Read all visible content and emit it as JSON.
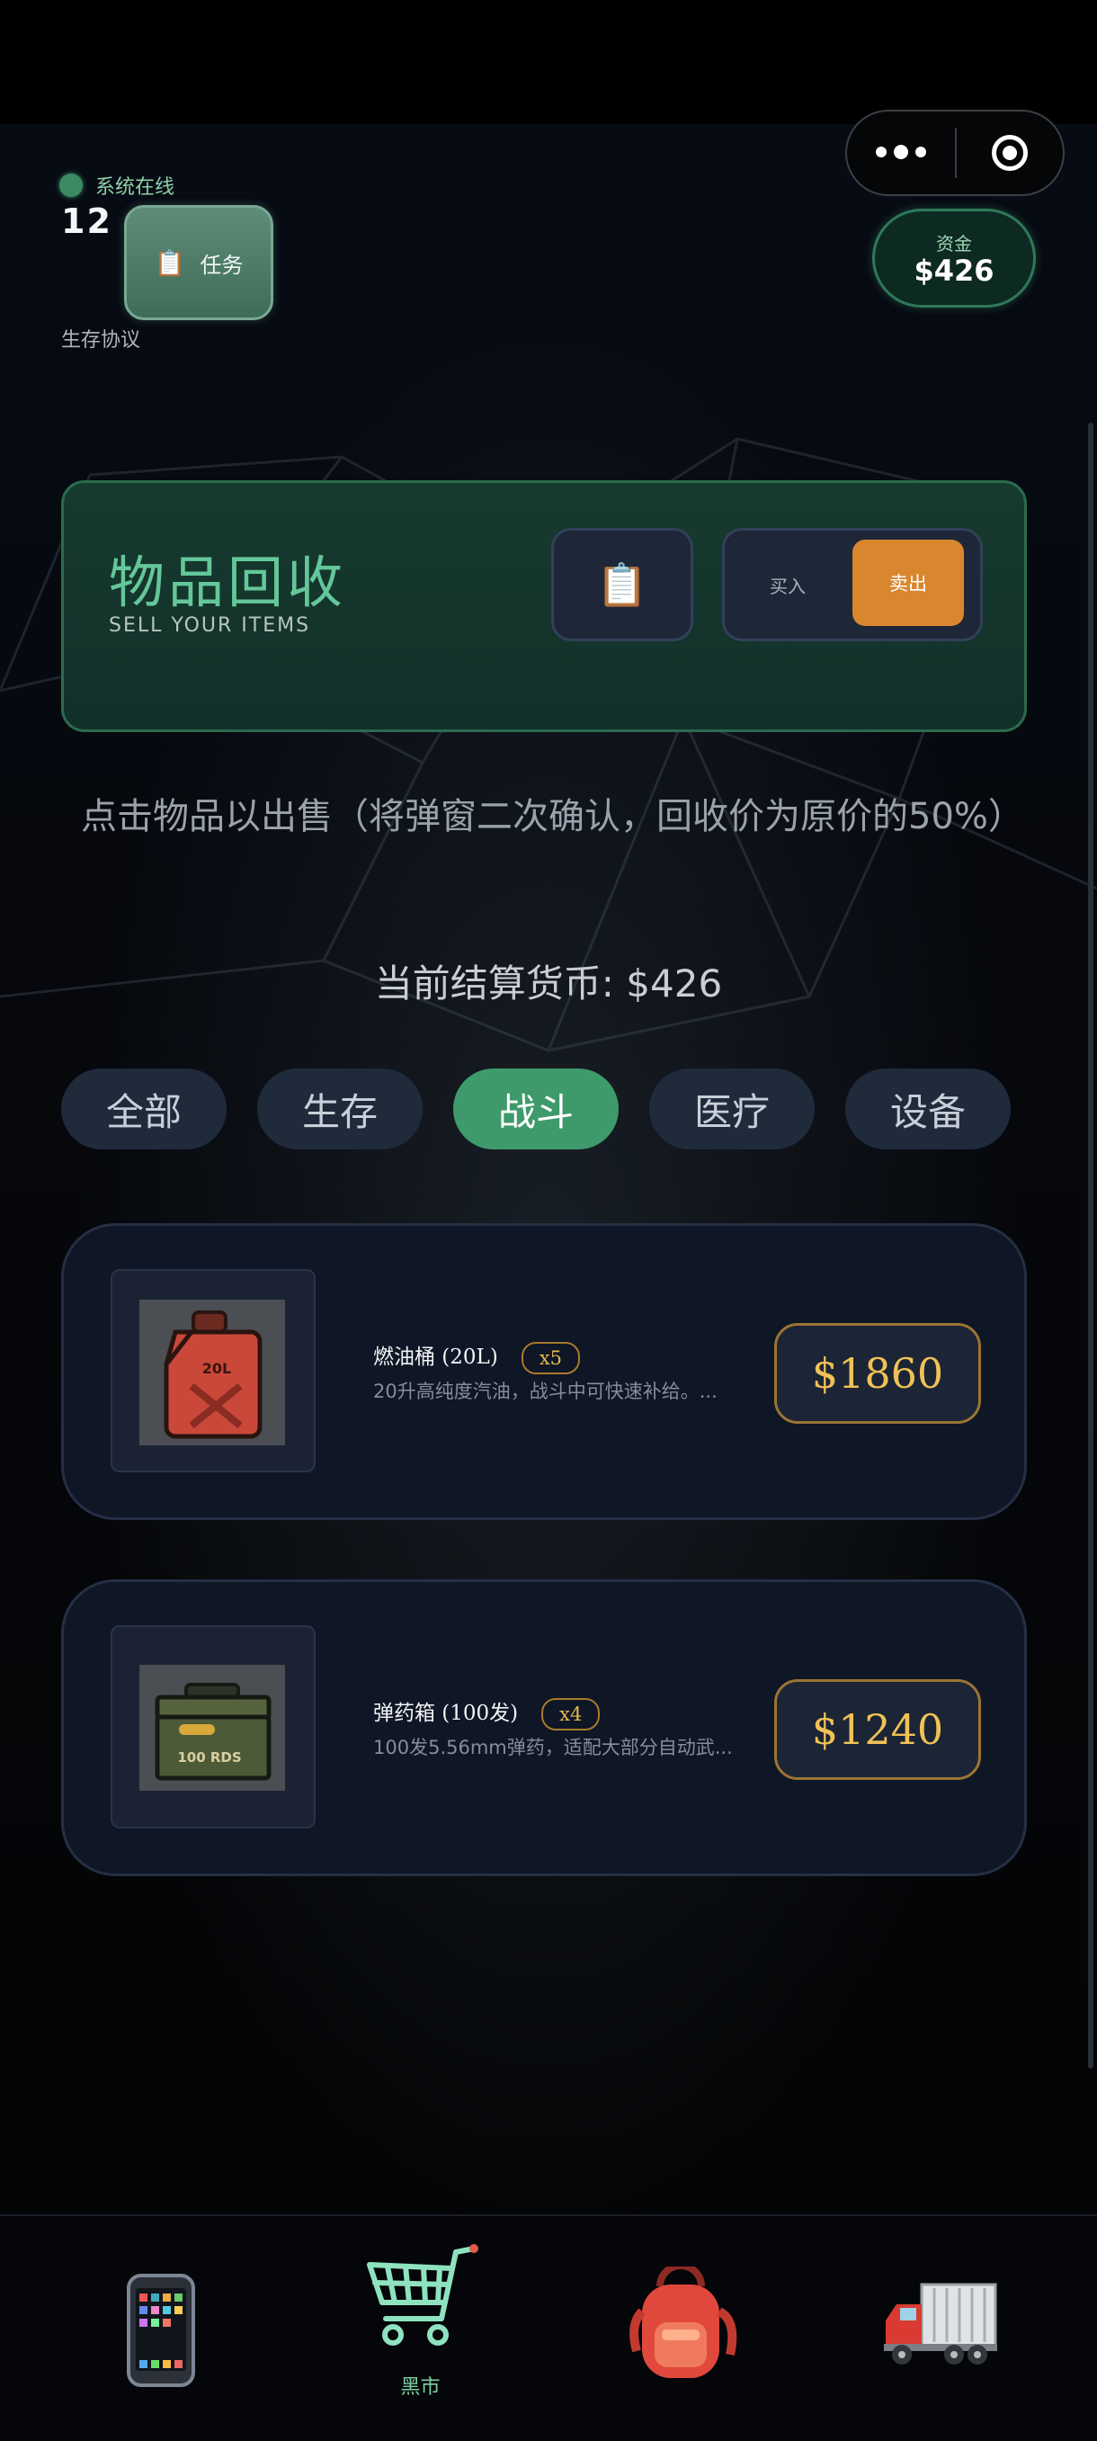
{
  "status": {
    "label": "系统在线",
    "indicator_color": "#3a8a62"
  },
  "player": {
    "level": "12",
    "protocol_label": "生存协议"
  },
  "task_button": {
    "icon": "clipboard-icon",
    "label": "任务"
  },
  "capsule": {
    "more_icon": "more-dots-icon",
    "close_icon": "target-circle-icon"
  },
  "funds": {
    "label": "资金",
    "value": "$426"
  },
  "hero": {
    "title": "物品回收",
    "subtitle": "SELL YOUR ITEMS",
    "clipboard_icon": "clipboard-icon",
    "toggle": {
      "buy_label": "买入",
      "sell_label": "卖出",
      "selected": "卖出"
    }
  },
  "hint": "点击物品以出售（将弹窗二次确认，回收价为原价的50%）",
  "balance": "当前结算货币: $426",
  "tabs": [
    {
      "label": "全部",
      "active": false
    },
    {
      "label": "生存",
      "active": false
    },
    {
      "label": "战斗",
      "active": true
    },
    {
      "label": "医疗",
      "active": false
    },
    {
      "label": "设备",
      "active": false
    }
  ],
  "items": [
    {
      "name": "燃油桶 (20L)",
      "qty": "x5",
      "desc": "20升高纯度汽油，战斗中可快速补给。...",
      "price": "$1860",
      "image_icon": "jerry-can-icon",
      "image_text": "20L"
    },
    {
      "name": "弹药箱 (100发)",
      "qty": "x4",
      "desc": "100发5.56mm弹药，适配大部分自动武...",
      "price": "$1240",
      "image_icon": "ammo-box-icon",
      "image_text": "100 RDS"
    }
  ],
  "bottom_nav": [
    {
      "icon": "phone-icon",
      "label": ""
    },
    {
      "icon": "shopping-cart-icon",
      "label": "黑市",
      "active": true
    },
    {
      "icon": "backpack-icon",
      "label": ""
    },
    {
      "icon": "delivery-truck-icon",
      "label": ""
    }
  ],
  "colors": {
    "accent_green": "#3f9a6b",
    "sell_orange": "#d9862f",
    "price_gold": "#f0c255"
  }
}
